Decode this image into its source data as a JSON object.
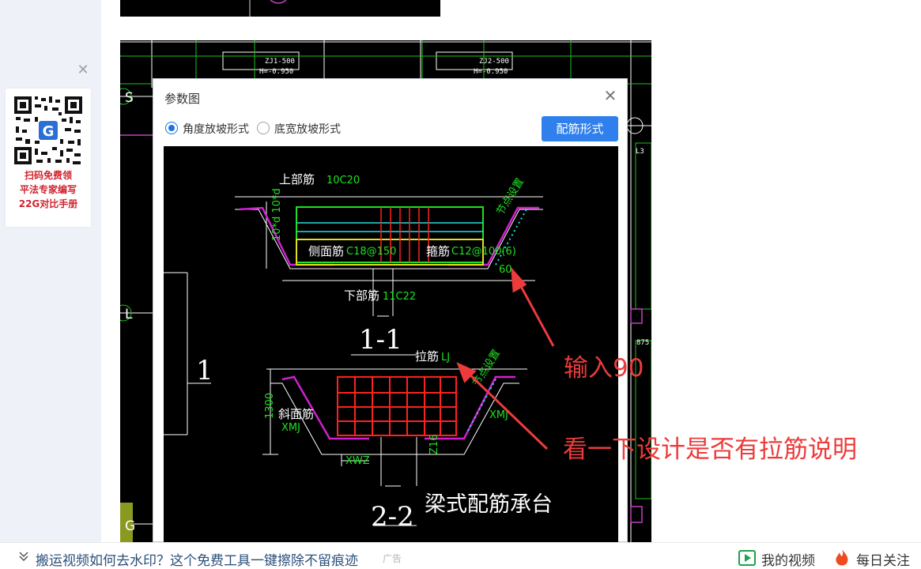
{
  "sidebar_ad": {
    "close_icon": "close-icon",
    "qr_icon": "qr-code-icon",
    "lines": [
      "扫码免费领",
      "平法专家编写",
      "22G对比手册"
    ]
  },
  "cad_drawing": {
    "labels": [
      "ZJ1-500",
      "H=-0.950",
      "ZJ2-500",
      "H=-0.950",
      "S",
      "L",
      "G",
      "875",
      "L3"
    ]
  },
  "dialog": {
    "title": "参数图",
    "options": [
      "角度放坡形式",
      "底宽放坡形式"
    ],
    "selected_option": "角度放坡形式",
    "button_label": "配筋形式",
    "diagram": {
      "section1_labels": {
        "top": "上部筋",
        "top_val": "10C20",
        "side": "侧面筋",
        "side_val": "C18@150",
        "stirrup": "箍筋",
        "stirrup_val": "C12@100(6)",
        "bottom": "下部筋",
        "bottom_val": "11C22",
        "node": "节点设置",
        "angle": "60",
        "dim": "10*d 10*d",
        "section_name": "1-1",
        "pier": "1"
      },
      "section2_labels": {
        "tie": "拉筋",
        "tie_val": "LJ",
        "slope": "斜面筋",
        "slope_val": "XMJ",
        "slope_val_r": "XMJ",
        "node": "节点设置",
        "height": "1300",
        "width": "XWZ",
        "bottom": "Z16",
        "section_name": "2-2",
        "caption": "梁式配筋承台"
      }
    }
  },
  "annotations": {
    "input_note": "输入90",
    "check_note": "看一下设计是否有拉筋说明",
    "color": "#ec3b3b"
  },
  "bottom_bar": {
    "chevron_icon": "chevron-down-icon",
    "link_text": "搬运视频如何去水印？这个免费工具一键擦除不留痕迹",
    "ad_tag": "广告",
    "video_icon": "play-video-icon",
    "video_label": "我的视频",
    "fire_icon": "fire-icon",
    "follow_label": "每日关注"
  }
}
